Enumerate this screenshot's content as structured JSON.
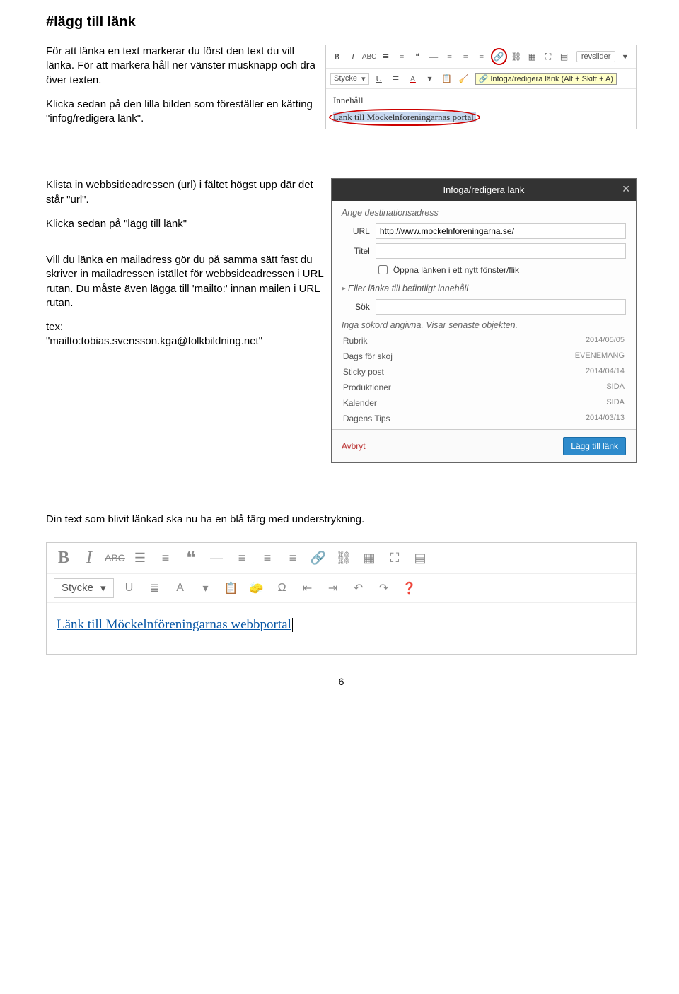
{
  "title": "#lägg till länk",
  "p1": "För att länka en text markerar du först den text du vill länka. För att markera håll ner vänster musknapp och dra över texten.",
  "p2": "Klicka sedan på den lilla bilden som föreställer en kätting \"infog/redigera länk\".",
  "toolbar": {
    "revslider": "revslider",
    "stycke": "Stycke",
    "tooltip": "Infoga/redigera länk (Alt + Skift + A)",
    "heading": "Innehåll",
    "selected_text": "Länk till Möckelnforeningarnas portal."
  },
  "p3": "Klista in webbsideadressen (url) i fältet högst upp där det står \"url\".",
  "p4": "Klicka sedan på \"lägg till länk\"",
  "p5": "Vill du länka en mailadress gör du på samma sätt fast du skriver in mailadressen istället för webbsideadressen i URL rutan. Du måste även lägga till 'mailto:' innan mailen i URL rutan.",
  "p6a": "tex:",
  "p6b": "\"mailto:tobias.svensson.kga@folkbildning.net\"",
  "dialog": {
    "title": "Infoga/redigera länk",
    "hint": "Ange destinationsadress",
    "url_label": "URL",
    "url_value": "http://www.mockelnforeningarna.se/",
    "title_label": "Titel",
    "checkbox": "Öppna länken i ett nytt fönster/flik",
    "collapse": "Eller länka till befintligt innehåll",
    "sok_label": "Sök",
    "results_info": "Inga sökord angivna. Visar senaste objekten.",
    "items": [
      {
        "t": "Rubrik",
        "m": "2014/05/05"
      },
      {
        "t": "Dags för skoj",
        "m": "EVENEMANG"
      },
      {
        "t": "Sticky post",
        "m": "2014/04/14"
      },
      {
        "t": "Produktioner",
        "m": "SIDA"
      },
      {
        "t": "Kalender",
        "m": "SIDA"
      },
      {
        "t": "Dagens Tips",
        "m": "2014/03/13"
      }
    ],
    "cancel": "Avbryt",
    "submit": "Lägg till länk"
  },
  "result_line": "Din text som blivit länkad ska nu ha en blå färg med understrykning.",
  "bottom": {
    "stycke": "Stycke",
    "linked_text": "Länk till Möckelnföreningarnas webbportal"
  },
  "page_num": "6"
}
